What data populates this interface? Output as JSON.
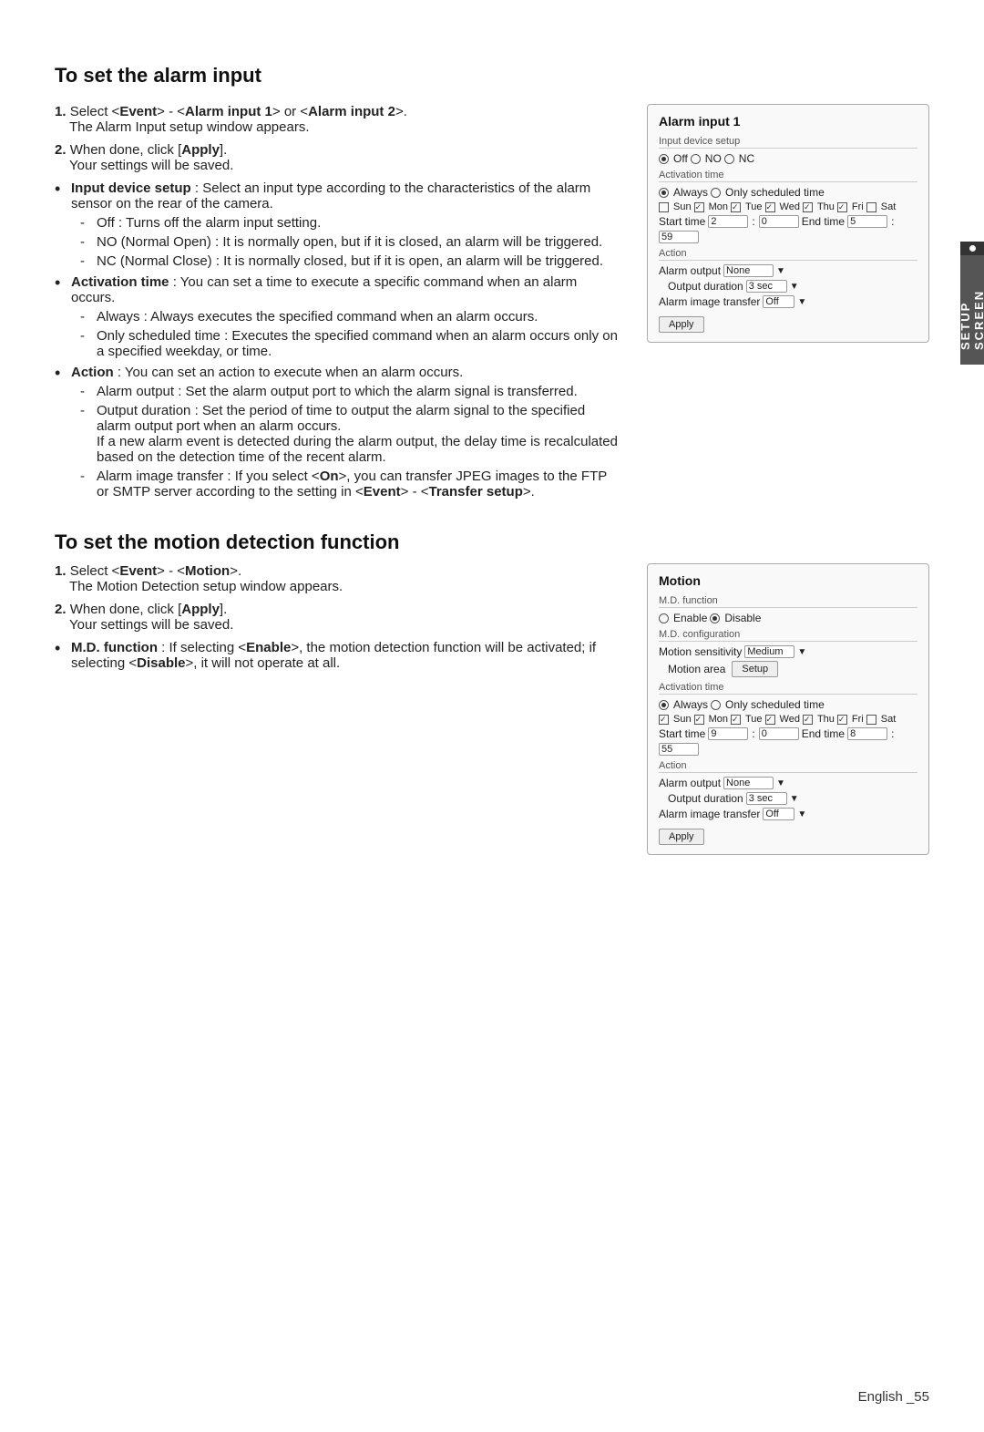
{
  "page": {
    "footer": "English _55",
    "side_tab": "SETUP SCREEN"
  },
  "alarm_section": {
    "title": "To set the alarm input",
    "panel_title": "Alarm input 1",
    "step1_num": "1.",
    "step1_main": "Select <Event> - <Alarm input 1> or <Alarm input 2>.",
    "step1_note": "The Alarm Input setup window appears.",
    "step2_num": "2.",
    "step2_main": "When done, click [Apply].",
    "step2_note": "Your settings will be saved.",
    "bullets": [
      {
        "label": "Input device setup",
        "colon": " : ",
        "text": "Select an input type according to the characteristics of the alarm sensor on the rear of the camera.",
        "dashes": [
          "Off : Turns off the alarm input setting.",
          "NO (Normal Open) : It is normally open, but if it is closed, an alarm will be triggered.",
          "NC (Normal Close) : It is normally closed, but if it is open, an alarm will be triggered."
        ]
      },
      {
        "label": "Activation time",
        "colon": " : ",
        "text": "You can set a time to execute a specific command when an alarm occurs.",
        "dashes": [
          "Always : Always executes the specified command when an alarm occurs.",
          "Only scheduled time : Executes the specified command when an alarm occurs only on a specified weekday, or time."
        ]
      },
      {
        "label": "Action",
        "colon": " : ",
        "text": "You can set an action to execute when an alarm occurs.",
        "dashes": [
          "Alarm output : Set the alarm output port to which the alarm signal is transferred.",
          "Output duration : Set the period of time to output the alarm signal to the specified alarm output port when an alarm occurs.\nIf a new alarm event is detected during the alarm output, the delay time is recalculated based on the detection time of the recent alarm.",
          "Alarm image transfer : If you select <On>, you can transfer JPEG images to the FTP or SMTP server according to the setting in <Event> - <Transfer setup>."
        ]
      }
    ],
    "panel": {
      "input_device_label": "Input device setup",
      "off_label": "Off",
      "no_label": "NO",
      "nc_label": "NC",
      "activation_label": "Activation time",
      "always_label": "Always",
      "only_scheduled_label": "Only scheduled time",
      "days_label": "Sun Mon Tue Wed Thu Fri Sat",
      "days": [
        "Sun",
        "Mon",
        "Tue",
        "Wed",
        "Thu",
        "Fri",
        "Sat"
      ],
      "start_time_label": "Start time",
      "start_h": "2",
      "start_m": "0",
      "end_time_label": "End time",
      "end_h": "5",
      "end_m": "59",
      "action_label": "Action",
      "alarm_output_label": "Alarm output",
      "alarm_output_val": "None",
      "output_duration_label": "Output duration",
      "output_duration_val": "3 sec",
      "alarm_image_label": "Alarm image transfer",
      "alarm_image_val": "Off",
      "apply_label": "Apply"
    }
  },
  "motion_section": {
    "title": "To set the motion detection function",
    "step1_num": "1.",
    "step1_main": "Select <Event> - <Motion>.",
    "step1_note": "The Motion Detection setup window appears.",
    "step2_num": "2.",
    "step2_main": "When done, click [Apply].",
    "step2_note": "Your settings will be saved.",
    "bullets": [
      {
        "label": "M.D. function",
        "colon": " : ",
        "text": "If selecting <Enable>, the motion detection function will be activated; if selecting <Disable>, it will not operate at all."
      }
    ],
    "panel_title": "Motion",
    "panel": {
      "md_function_label": "M.D. function",
      "enable_label": "Enable",
      "disable_label": "Disable",
      "md_config_label": "M.D. configuration",
      "sensitivity_label": "Motion sensitivity",
      "sensitivity_val": "Medium",
      "motion_area_label": "Motion area",
      "setup_btn": "Setup",
      "activation_label": "Activation time",
      "always_label": "Always",
      "only_scheduled_label": "Only scheduled time",
      "days": [
        "Sun",
        "Mon",
        "Tue",
        "Wed",
        "Thu",
        "Fri",
        "Sat"
      ],
      "start_time_label": "Start time",
      "start_h": "9",
      "start_m": "0",
      "end_time_label": "End time",
      "end_h": "8",
      "end_m": "55",
      "action_label": "Action",
      "alarm_output_label": "Alarm output",
      "alarm_output_val": "None",
      "output_duration_label": "Output duration",
      "output_duration_val": "3 sec",
      "alarm_image_label": "Alarm image transfer",
      "alarm_image_val": "Off",
      "apply_label": "Apply"
    }
  }
}
